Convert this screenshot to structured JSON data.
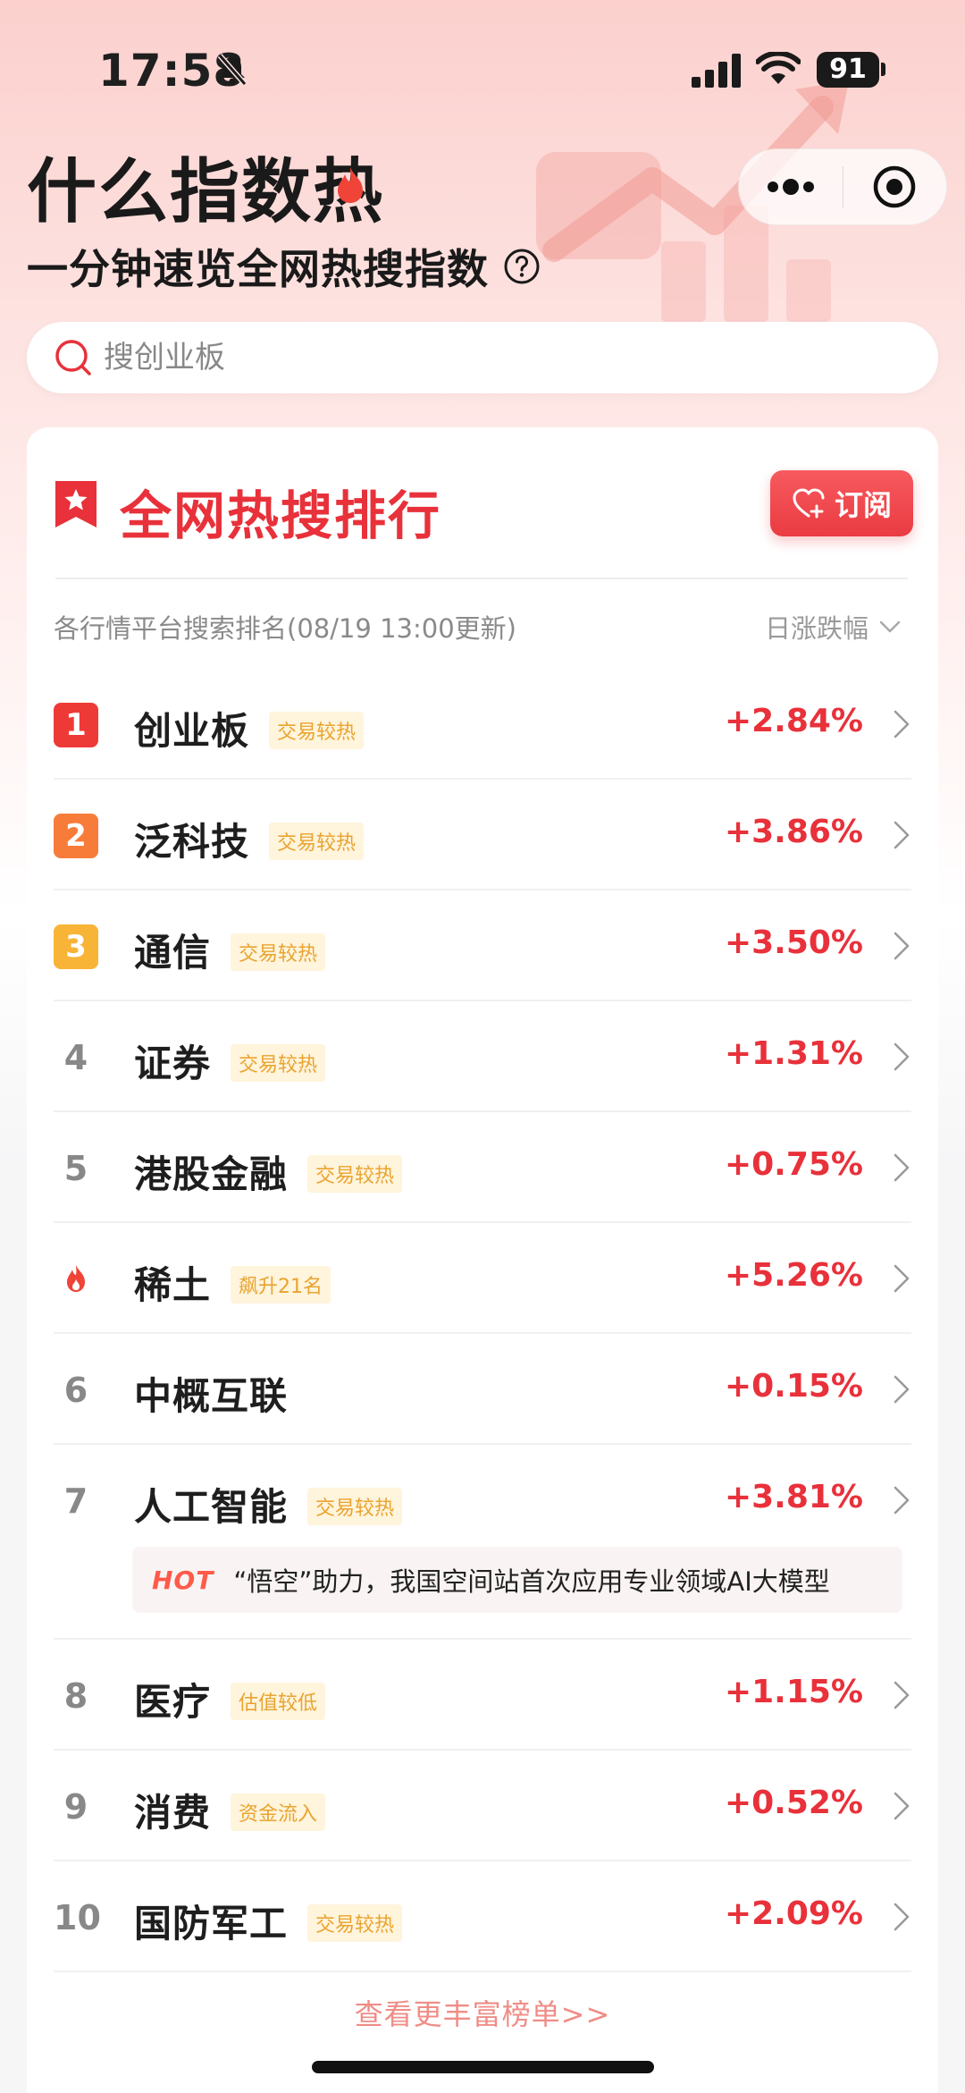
{
  "status_bar": {
    "time": "17:58",
    "battery": "91"
  },
  "header": {
    "title": "什么指数热",
    "subtitle": "一分钟速览全网热搜指数"
  },
  "search": {
    "placeholder": "搜创业板"
  },
  "ranking": {
    "title": "全网热搜排行",
    "subscribe_label": "订阅",
    "update_note": "各行情平台搜索排名(08/19 13:00更新)",
    "sort_label": "日涨跌幅",
    "items": [
      {
        "rank": "1",
        "name": "创业板",
        "tag": "交易较热",
        "change": "+2.84%"
      },
      {
        "rank": "2",
        "name": "泛科技",
        "tag": "交易较热",
        "change": "+3.86%"
      },
      {
        "rank": "3",
        "name": "通信",
        "tag": "交易较热",
        "change": "+3.50%"
      },
      {
        "rank": "4",
        "name": "证券",
        "tag": "交易较热",
        "change": "+1.31%"
      },
      {
        "rank": "5",
        "name": "港股金融",
        "tag": "交易较热",
        "change": "+0.75%"
      },
      {
        "rank": "",
        "name": "稀土",
        "tag": "飙升21名",
        "change": "+5.26%"
      },
      {
        "rank": "6",
        "name": "中概互联",
        "tag": "",
        "change": "+0.15%"
      },
      {
        "rank": "7",
        "name": "人工智能",
        "tag": "交易较热",
        "change": "+3.81%",
        "hot_label": "HOT",
        "news": "“悟空”助力，我国空间站首次应用专业领域AI大模型"
      },
      {
        "rank": "8",
        "name": "医疗",
        "tag": "估值较低",
        "change": "+1.15%"
      },
      {
        "rank": "9",
        "name": "消费",
        "tag": "资金流入",
        "change": "+0.52%"
      },
      {
        "rank": "10",
        "name": "国防军工",
        "tag": "交易较热",
        "change": "+2.09%"
      }
    ],
    "more_link": "查看更丰富榜单>>"
  },
  "colors": {
    "accent_red": "#e8313a",
    "rank1": "#ee3a37",
    "rank2": "#f77c3a",
    "rank3": "#f8b436",
    "tag_text": "#e9a42f"
  }
}
